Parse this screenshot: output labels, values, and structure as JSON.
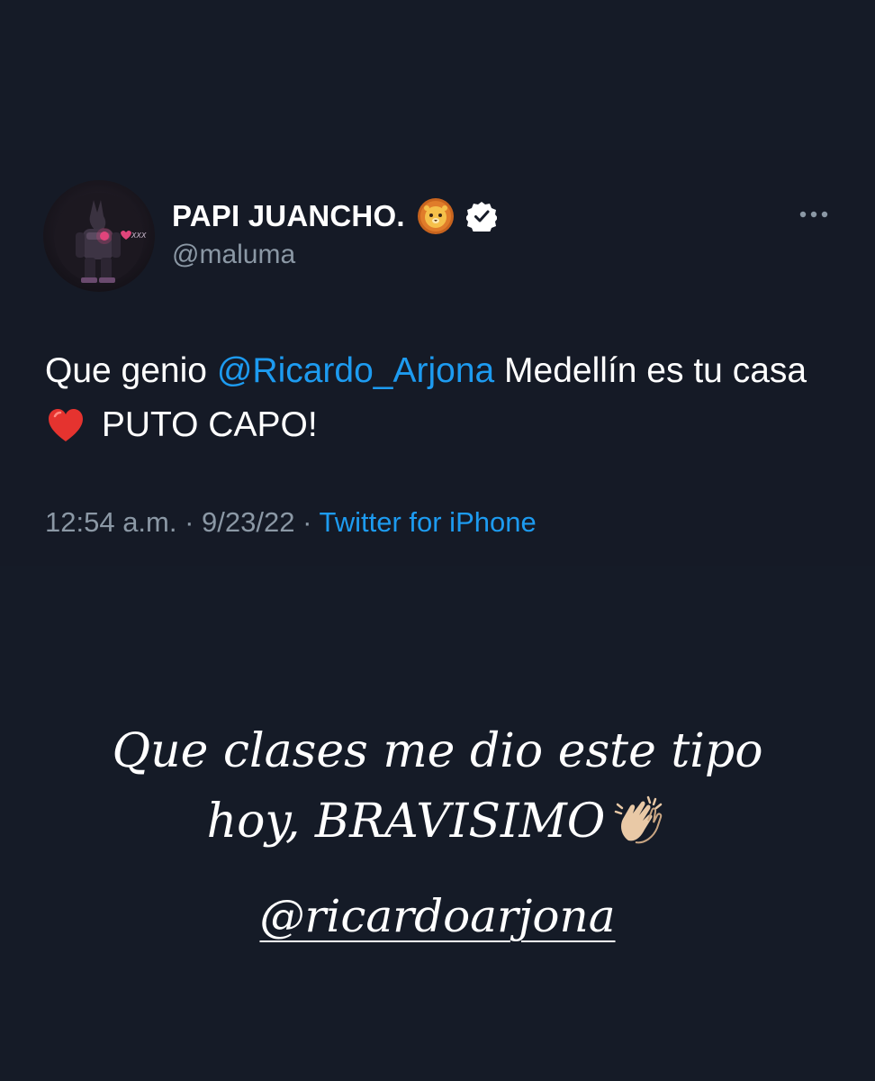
{
  "tweet": {
    "display_name": "PAPI JUANCHO.",
    "name_emoji_icon": "lion-face-icon",
    "verified_icon": "verified-badge-icon",
    "handle": "@maluma",
    "more_icon": "more-options-icon",
    "text_part1": "Que genio ",
    "mention": "@Ricardo_Arjona",
    "text_part2": " Medellín es tu casa",
    "heart_icon": "red-heart-icon",
    "text_part3": " PUTO CAPO!",
    "time": "12:54 a.m.",
    "separator": " · ",
    "date": "9/23/22",
    "source": "Twitter for iPhone",
    "avatar_text": "XXX"
  },
  "story": {
    "caption_line1": "Que clases me dio este tipo",
    "caption_line2": "hoy, BRAVISIMO",
    "clap_icon": "clapping-hands-icon",
    "mention": "@ricardoarjona"
  },
  "colors": {
    "background": "#151b27",
    "link": "#1d9bf0",
    "secondary_text": "#8b98a5",
    "primary_text": "#ffffff"
  }
}
